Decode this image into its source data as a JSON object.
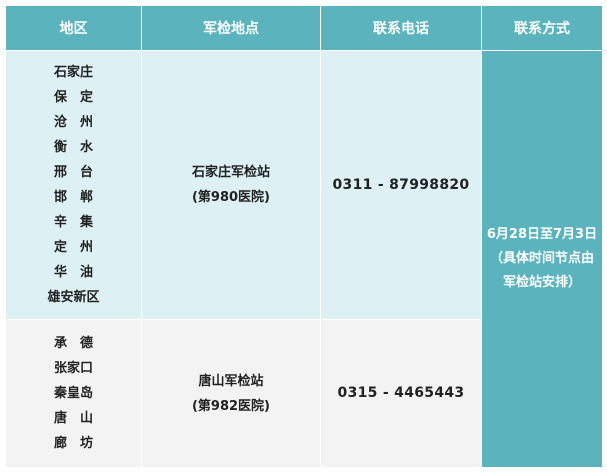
{
  "headers": [
    "地区",
    "军检地点",
    "联系电话",
    "联系方式"
  ],
  "rows": [
    {
      "areas": [
        "石家庄",
        "保　定",
        "沧　州",
        "衡　水",
        "邢　台",
        "邯　郸",
        "辛　集",
        "定　州",
        "华　油",
        "雄安新区"
      ],
      "site_name": "石家庄军检站",
      "site_hospital": "(第980医院)",
      "phone": "0311 - 87998820"
    },
    {
      "areas": [
        "承　德",
        "张家口",
        "秦皇岛",
        "唐　山",
        "廊　坊"
      ],
      "site_name": "唐山军检站",
      "site_hospital": "(第982医院)",
      "phone": "0315 - 4465443"
    }
  ],
  "contact": {
    "line1": "6月28日至7月3日",
    "line2": "（具体时间节点由",
    "line3": "军检站安排）"
  },
  "colors": {
    "header_bg": "#5ab3bd",
    "row1_bg": "#ddf1f5",
    "row2_bg": "#f3f3f3",
    "contact_bg": "#5ab3bd"
  }
}
